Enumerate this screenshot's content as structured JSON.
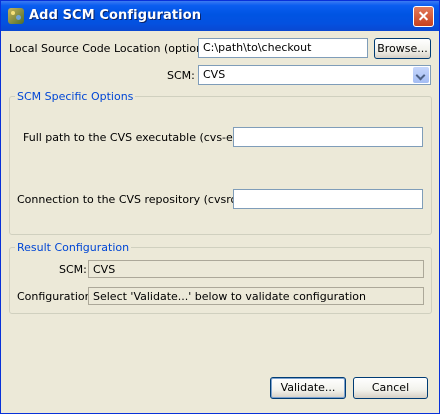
{
  "window": {
    "title": "Add SCM Configuration"
  },
  "source": {
    "label": "Local Source Code Location (optional):",
    "value": "C:\\path\\to\\checkout",
    "browse_label": "Browse..."
  },
  "scm": {
    "label": "SCM:",
    "selected": "CVS"
  },
  "specific": {
    "legend": "SCM Specific Options",
    "exe_label": "Full path to the CVS executable (cvs-exe):",
    "exe_value": "",
    "root_label": "Connection to the CVS repository (cvsroot):",
    "root_value": ""
  },
  "result": {
    "legend": "Result Configuration",
    "scm_label": "SCM:",
    "scm_value": "CVS",
    "config_label": "Configuration:",
    "config_value": "Select 'Validate...' below to validate configuration"
  },
  "buttons": {
    "validate": "Validate...",
    "cancel": "Cancel"
  }
}
